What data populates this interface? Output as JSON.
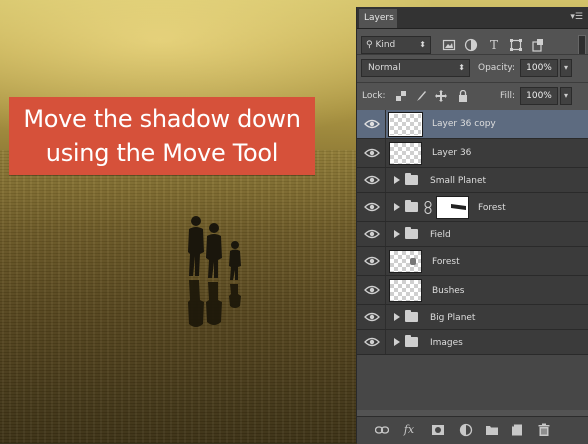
{
  "caption": {
    "line1": "Move the shadow down",
    "line2": "using the Move Tool"
  },
  "layers_panel": {
    "tab_label": "Layers",
    "menu_icon": "panel-menu-icon",
    "filter": {
      "kind_label": "Kind",
      "filter_icons": [
        "pixel-filter-icon",
        "adjustment-filter-icon",
        "type-filter-icon",
        "shape-filter-icon",
        "smart-object-filter-icon"
      ],
      "type_glyph": "T"
    },
    "blend_mode": "Normal",
    "opacity_label": "Opacity:",
    "opacity_value": "100%",
    "lock_label": "Lock:",
    "fill_label": "Fill:",
    "fill_value": "100%",
    "layers": [
      {
        "name": "Layer 36 copy",
        "kind": "layer",
        "selected": true
      },
      {
        "name": "Layer 36",
        "kind": "layer",
        "selected": false
      },
      {
        "name": "Small Planet",
        "kind": "group",
        "selected": false
      },
      {
        "name": "Forest",
        "kind": "group-masked",
        "selected": false
      },
      {
        "name": "Field",
        "kind": "group",
        "selected": false
      },
      {
        "name": "Forest",
        "kind": "layer",
        "selected": false
      },
      {
        "name": "Bushes",
        "kind": "layer",
        "selected": false
      },
      {
        "name": "Big Planet",
        "kind": "group",
        "selected": false
      },
      {
        "name": "Images",
        "kind": "group",
        "selected": false
      }
    ],
    "footer": {
      "fx_label": "fx"
    }
  },
  "colors": {
    "caption_bg": "#d6513a",
    "panel_bg": "#535353",
    "selected_layer": "#5d6b80"
  }
}
